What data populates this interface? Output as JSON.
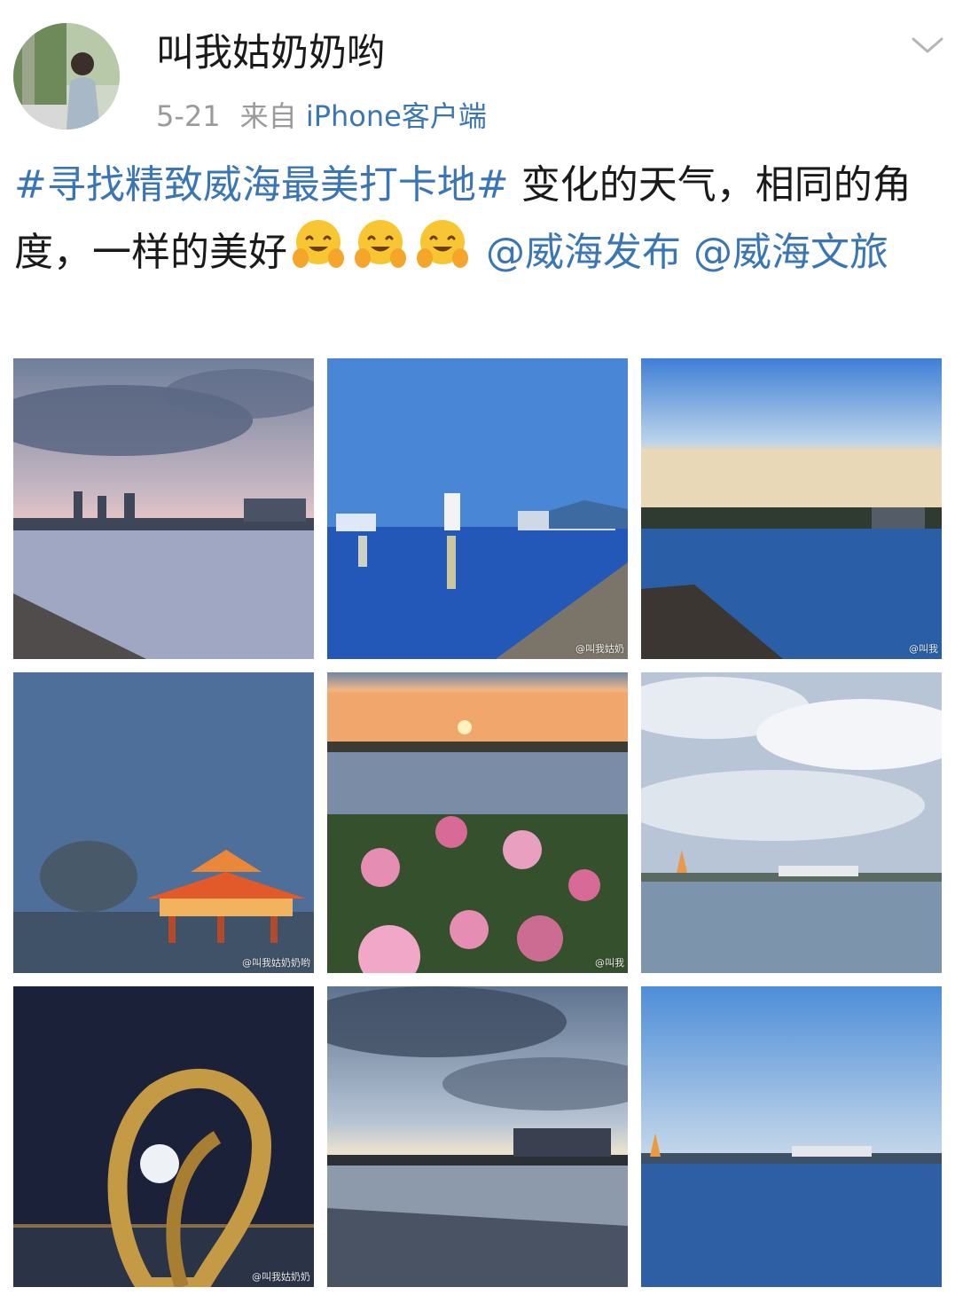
{
  "user": {
    "name": "叫我姑奶奶哟"
  },
  "meta": {
    "time": "5-21",
    "from_label": "来自",
    "client": "iPhone客户端"
  },
  "post": {
    "hashtag": "#寻找精致威海最美打卡地#",
    "text": " 变化的天气，相同的角度，一样的美好",
    "emojis": [
      "hugging-face",
      "hugging-face",
      "hugging-face"
    ],
    "mention_1": "@威海发布",
    "mention_2": "@威海文旅"
  },
  "photos": [
    {
      "scene": "lake-sunset-clouds",
      "watermark": ""
    },
    {
      "scene": "blue-hour-city-reflection",
      "watermark": "@叫我姑奶"
    },
    {
      "scene": "lake-clear-sky",
      "watermark": "@叫我"
    },
    {
      "scene": "lit-pavilion-fog",
      "watermark": "@叫我姑奶奶哟"
    },
    {
      "scene": "flowers-sunset",
      "watermark": "@叫我"
    },
    {
      "scene": "lake-cloudy",
      "watermark": ""
    },
    {
      "scene": "golden-sculpture-night",
      "watermark": "@叫我姑奶奶"
    },
    {
      "scene": "lake-dusk-clouds",
      "watermark": ""
    },
    {
      "scene": "lake-blue-calm",
      "watermark": ""
    }
  ],
  "colors": {
    "link": "#3a75b5",
    "meta": "#9a9a9a",
    "text": "#1a1a1a"
  }
}
